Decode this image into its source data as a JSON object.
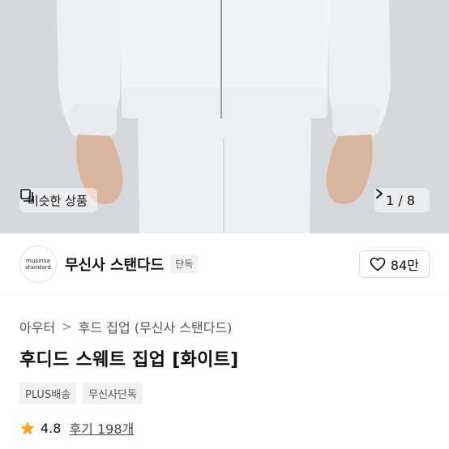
{
  "image": {
    "similar_label": "비슷한 상품",
    "pager_text": "1 / 8"
  },
  "brand": {
    "logo_line1": "musinsa",
    "logo_line2": "standard",
    "name": "무신사 스탠다드",
    "badge": "단독",
    "likes": "84만"
  },
  "breadcrumb": [
    "아우터",
    "후드 집업 (무신사 스탠다드)"
  ],
  "product": {
    "title": "후디드 스웨트 집업 [화이트]",
    "tags": [
      "PLUS배송",
      "무신사단독"
    ]
  },
  "rating": {
    "score": "4.8",
    "reviews": "후기 198개"
  },
  "colors": {
    "star": "#f5a623",
    "background": "#d9dbdf"
  }
}
